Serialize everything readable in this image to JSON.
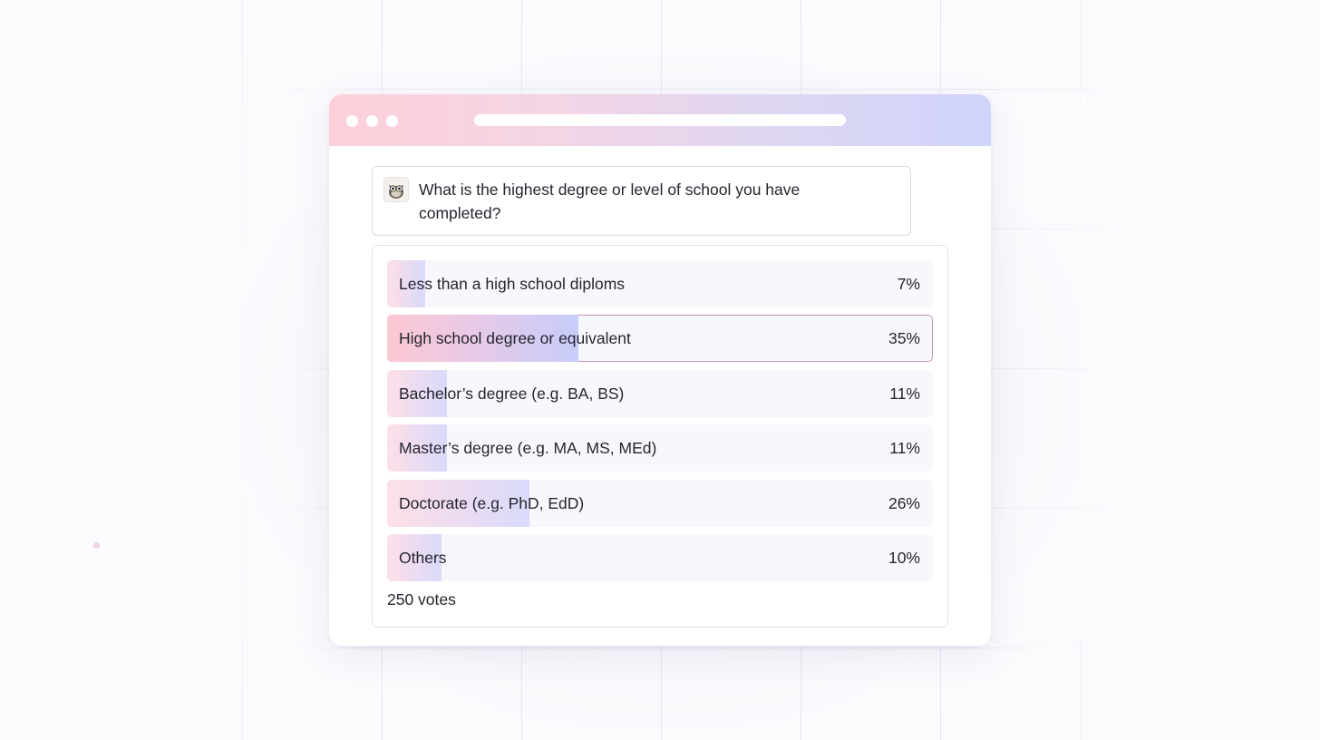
{
  "question": {
    "text": "What is the highest degree or level of school you have completed?"
  },
  "poll": {
    "options": [
      {
        "label": "Less than a high school diploms",
        "percent_text": "7%",
        "percent": 7,
        "selected": false
      },
      {
        "label": "High school degree or equivalent",
        "percent_text": "35%",
        "percent": 35,
        "selected": true
      },
      {
        "label": "Bachelor’s degree (e.g. BA, BS)",
        "percent_text": "11%",
        "percent": 11,
        "selected": false
      },
      {
        "label": "Master’s degree (e.g. MA, MS, MEd)",
        "percent_text": "11%",
        "percent": 11,
        "selected": false
      },
      {
        "label": "Doctorate (e.g. PhD, EdD)",
        "percent_text": "26%",
        "percent": 26,
        "selected": false
      },
      {
        "label": "Others",
        "percent_text": "10%",
        "percent": 10,
        "selected": false
      }
    ],
    "votes_text": "250 votes"
  },
  "theme": {
    "selected_border": "#c990b8",
    "gradient_start": "#fdd0d8",
    "gradient_end": "#cfd4fb"
  },
  "icons": {
    "avatar": "owl-avatar-icon"
  }
}
